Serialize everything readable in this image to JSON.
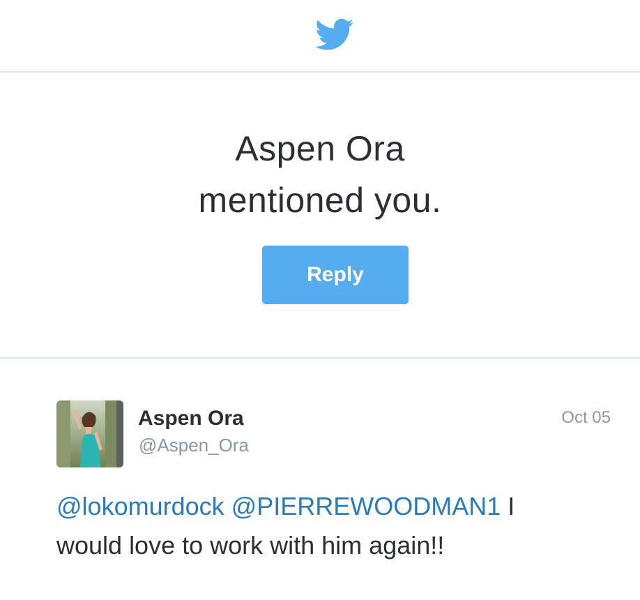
{
  "brand": {
    "logo_icon": "twitter-bird-icon",
    "accent_color": "#55acee"
  },
  "notification": {
    "headline_line1": "Aspen Ora",
    "headline_line2": "mentioned you.",
    "reply_label": "Reply"
  },
  "tweet": {
    "author_name": "Aspen Ora",
    "author_handle": "@Aspen_Ora",
    "date": "Oct 05",
    "avatar_icon": "profile-photo",
    "mention1": "@lokomurdock",
    "mention2": "@PIERREWOODMAN1",
    "text_rest": "I would love to work with him again!!"
  }
}
